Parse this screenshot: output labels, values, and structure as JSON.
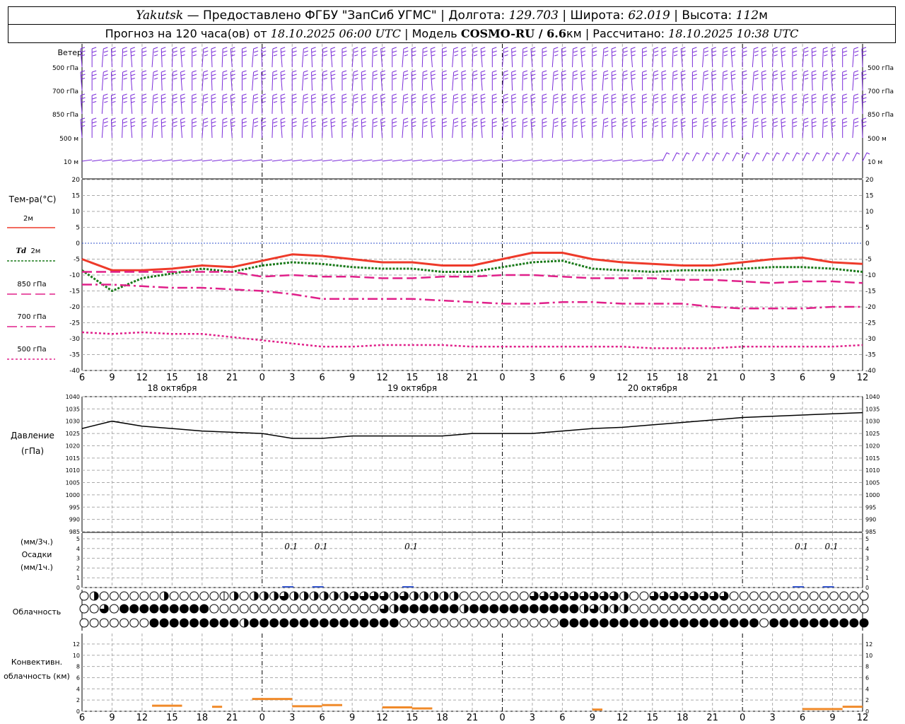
{
  "header": {
    "station": "Yakutsk",
    "provider": "— Предоставлено ФГБУ \"ЗапСиб УГМС\"",
    "lon_label": "| Долгота:",
    "lon": "129.703",
    "lat_label": "| Широта:",
    "lat": "62.019",
    "alt_label": "| Высота:",
    "alt": "112",
    "alt_unit": "м",
    "forecast_prefix": "Прогноз на 120 часа(ов) от",
    "forecast_start": "18.10.2025 06:00 UTC",
    "model_label": "| Модель",
    "model": "COSMO-RU / 6.6",
    "model_unit": "км",
    "calc_label": "| Рассчитано:",
    "calc_time": "18.10.2025 10:38 UTC"
  },
  "colors": {
    "wind": "#7a2bd9",
    "t2m": "#ee3a2a",
    "td2m": "#1a7a1a",
    "t850": "#e0208a",
    "t700": "#e0208a",
    "t500": "#e0208a",
    "zero": "#3355cc",
    "grid": "#aaaaaa",
    "precip": "#3355cc",
    "conv": "#f08a2a"
  },
  "wind_panel": {
    "title": "Ветер",
    "levels": [
      "500 гПа",
      "700 гПа",
      "850 гПа",
      "500 м",
      "10 м"
    ]
  },
  "time_axis": {
    "hour_labels": [
      "6",
      "9",
      "12",
      "15",
      "18",
      "21",
      "0",
      "3",
      "6",
      "9",
      "12",
      "15",
      "18",
      "21",
      "0",
      "3",
      "6",
      "9",
      "12",
      "15",
      "18",
      "21",
      "0",
      "3",
      "6",
      "9",
      "12"
    ],
    "day_labels": [
      "18 октября",
      "19 октября",
      "20 октября"
    ]
  },
  "chart_data": [
    {
      "type": "line",
      "title": "Тем-ра(°C)",
      "x_hours": [
        6,
        9,
        12,
        15,
        18,
        21,
        24,
        27,
        30,
        33,
        36,
        39,
        42,
        45,
        48,
        51,
        54,
        57,
        60,
        63,
        66,
        69,
        72,
        75,
        78,
        81,
        84
      ],
      "ylim": [
        -40,
        20
      ],
      "yticks": [
        20,
        15,
        10,
        5,
        0,
        -5,
        -10,
        -15,
        -20,
        -25,
        -30,
        -35,
        -40
      ],
      "series": [
        {
          "name": "2м",
          "values": [
            -5,
            -8.5,
            -8.5,
            -8,
            -7,
            -7.5,
            -5.5,
            -3.5,
            -4,
            -5,
            -6,
            -6,
            -7,
            -7,
            -5,
            -3,
            -3,
            -5,
            -6,
            -6.5,
            -7,
            -7,
            -6,
            -5,
            -4.5,
            -6,
            -6.5
          ]
        },
        {
          "name": "Td 2м",
          "values": [
            -8.5,
            -15,
            -11,
            -9.5,
            -8,
            -9,
            -7,
            -6,
            -6.5,
            -7.5,
            -8,
            -8,
            -9,
            -9,
            -7.5,
            -6,
            -5.5,
            -8,
            -8.5,
            -9,
            -8.5,
            -8.5,
            -8,
            -7.5,
            -7.5,
            -8,
            -9
          ]
        },
        {
          "name": "850 гПа",
          "values": [
            -9,
            -9,
            -9,
            -9,
            -9,
            -9,
            -10.5,
            -10,
            -10.5,
            -10.5,
            -11,
            -11,
            -10.5,
            -10.5,
            -10,
            -10,
            -10.5,
            -11,
            -11,
            -11,
            -11.5,
            -11.5,
            -12,
            -12.5,
            -12,
            -12,
            -12.5
          ]
        },
        {
          "name": "700 гПа",
          "values": [
            -13,
            -13,
            -13.5,
            -14,
            -14,
            -14.5,
            -15,
            -16,
            -17.5,
            -17.5,
            -17.5,
            -17.5,
            -18,
            -18.5,
            -19,
            -19,
            -18.5,
            -18.5,
            -19,
            -19,
            -19,
            -20,
            -20.5,
            -20.5,
            -20.5,
            -20,
            -20
          ]
        },
        {
          "name": "500 гПа",
          "values": [
            -28,
            -28.5,
            -28,
            -28.5,
            -28.5,
            -29.5,
            -30.5,
            -31.5,
            -32.5,
            -32.5,
            -32,
            -32,
            -32,
            -32.5,
            -32.5,
            -32.5,
            -32.5,
            -32.5,
            -32.5,
            -33,
            -33,
            -33,
            -32.5,
            -32.5,
            -32.5,
            -32.5,
            -32
          ]
        }
      ]
    },
    {
      "type": "line",
      "ylabel": "Давление",
      "yunit": "(гПа)",
      "x_hours": [
        6,
        9,
        12,
        15,
        18,
        21,
        24,
        27,
        30,
        33,
        36,
        39,
        42,
        45,
        48,
        51,
        54,
        57,
        60,
        63,
        66,
        69,
        72,
        75,
        78,
        81,
        84
      ],
      "ylim": [
        985,
        1040
      ],
      "yticks": [
        1040,
        1035,
        1030,
        1025,
        1020,
        1015,
        1010,
        1005,
        1000,
        995,
        990,
        985
      ],
      "series": [
        {
          "values": [
            1027,
            1030,
            1028,
            1027,
            1026,
            1025.5,
            1025,
            1023,
            1023,
            1024,
            1024,
            1024,
            1024,
            1025,
            1025,
            1025,
            1026,
            1027,
            1027.5,
            1028.5,
            1029.5,
            1030.5,
            1031.5,
            1032,
            1032.5,
            1033,
            1033.5
          ]
        }
      ]
    },
    {
      "type": "bar",
      "ylabel": "(мм/3ч.)",
      "title": "Осадки",
      "yunit": "(мм/1ч.)",
      "ylim": [
        0,
        5
      ],
      "yticks": [
        5,
        4,
        3,
        2,
        1,
        0
      ],
      "annotations": [
        {
          "x_hour": 27,
          "text": "0.1"
        },
        {
          "x_hour": 30,
          "text": "0.1"
        },
        {
          "x_hour": 39,
          "text": "0.1"
        },
        {
          "x_hour": 78,
          "text": "0.1"
        },
        {
          "x_hour": 81,
          "text": "0.1"
        }
      ]
    },
    {
      "type": "table",
      "title": "Облачность",
      "note": "cloud cover symbols, octas (0-8) per hour, three levels",
      "rows": [
        [
          0,
          4,
          4,
          0,
          0,
          0,
          0,
          0,
          0,
          0,
          0,
          0,
          4,
          0,
          0,
          0,
          0,
          0,
          0,
          0,
          0,
          0,
          2,
          4,
          6,
          0,
          4,
          6,
          4,
          6,
          4,
          6,
          4,
          4,
          4,
          4,
          4,
          4,
          4,
          4,
          4,
          4,
          6,
          4,
          6,
          6,
          4,
          6,
          6,
          4,
          6,
          4,
          4,
          4,
          4,
          4,
          4,
          4,
          4,
          4,
          0,
          0,
          0,
          0,
          0,
          0,
          0,
          0,
          0,
          0,
          0,
          6,
          6,
          4,
          6,
          6,
          6,
          6,
          6,
          6,
          6,
          6,
          6,
          6,
          4,
          4,
          0,
          0,
          0,
          0,
          6,
          6,
          0,
          6,
          6,
          6,
          6,
          4,
          6,
          6,
          4,
          6,
          0,
          0,
          0,
          0,
          0,
          0,
          0,
          0,
          0,
          0,
          0,
          0,
          0,
          0,
          0,
          0,
          0,
          0,
          0,
          0,
          0,
          0,
          0
        ],
        [
          0,
          0,
          4,
          6,
          0,
          8,
          8,
          8,
          8,
          8,
          8,
          8,
          8,
          8,
          8,
          8,
          8,
          8,
          8,
          8,
          0,
          0,
          0,
          0,
          0,
          0,
          0,
          0,
          0,
          0,
          0,
          0,
          0,
          0,
          0,
          0,
          0,
          0,
          0,
          0,
          0,
          0,
          4,
          0,
          0,
          0,
          0,
          0,
          6,
          4,
          8,
          8,
          8,
          8,
          8,
          8,
          8,
          8,
          8,
          8,
          8,
          4,
          8,
          8,
          8,
          8,
          8,
          8,
          8,
          8,
          8,
          8,
          8,
          8,
          8,
          8,
          8,
          8,
          8,
          4,
          4,
          6,
          6,
          4,
          6,
          4,
          4,
          4,
          0,
          0,
          0,
          0,
          0,
          0,
          0,
          0,
          0,
          0,
          0,
          0,
          0,
          0,
          0,
          0,
          0,
          0,
          0,
          0,
          0,
          0,
          0,
          0,
          0,
          0,
          0,
          0,
          0,
          0,
          0,
          0,
          0,
          0,
          0,
          0,
          0,
          0,
          0
        ],
        [
          0,
          0,
          0,
          0,
          0,
          0,
          0,
          0,
          0,
          0,
          4,
          8,
          8,
          8,
          8,
          8,
          8,
          8,
          8,
          8,
          8,
          8,
          8,
          8,
          8,
          4,
          8,
          8,
          8,
          8,
          8,
          8,
          8,
          8,
          8,
          8,
          8,
          8,
          8,
          8,
          4,
          8,
          8,
          8,
          8,
          8,
          8,
          8,
          8,
          8,
          0,
          0,
          0,
          0,
          0,
          0,
          0,
          0,
          0,
          0,
          0,
          0,
          0,
          0,
          0,
          0,
          0,
          0,
          0,
          0,
          0,
          0,
          0,
          0,
          0,
          0,
          8,
          8,
          8,
          8,
          8,
          8,
          8,
          8,
          8,
          8,
          8,
          8,
          8,
          8,
          8,
          8,
          8,
          8,
          8,
          8,
          8,
          8,
          8,
          8,
          8,
          8,
          8,
          8,
          8,
          8,
          8,
          0,
          0,
          8,
          8,
          8,
          8,
          8,
          8,
          8,
          8,
          8,
          8,
          8,
          8,
          8,
          8,
          8,
          8,
          8
        ]
      ]
    },
    {
      "type": "bar",
      "ylabel": "Конвективн. облачность (км)",
      "ylim": [
        0,
        13
      ],
      "yticks": [
        12,
        10,
        8,
        6,
        4,
        2,
        0
      ],
      "segments": [
        {
          "from": 13,
          "to": 16,
          "value": 1.0
        },
        {
          "from": 19,
          "to": 20,
          "value": 0.8
        },
        {
          "from": 23,
          "to": 27,
          "value": 2.2
        },
        {
          "from": 27,
          "to": 30,
          "value": 0.9
        },
        {
          "from": 30,
          "to": 32,
          "value": 1.1
        },
        {
          "from": 36,
          "to": 39,
          "value": 0.7
        },
        {
          "from": 39,
          "to": 41,
          "value": 0.5
        },
        {
          "from": 57,
          "to": 58,
          "value": 0.3
        },
        {
          "from": 78,
          "to": 82,
          "value": 0.4
        },
        {
          "from": 82,
          "to": 84,
          "value": 0.8
        }
      ]
    }
  ],
  "legend": {
    "t2m": "2м",
    "td_prefix": "Td",
    "td_suffix": "2м",
    "t850": "850 гПа",
    "t700": "700 гПа",
    "t500": "500 гПа"
  }
}
